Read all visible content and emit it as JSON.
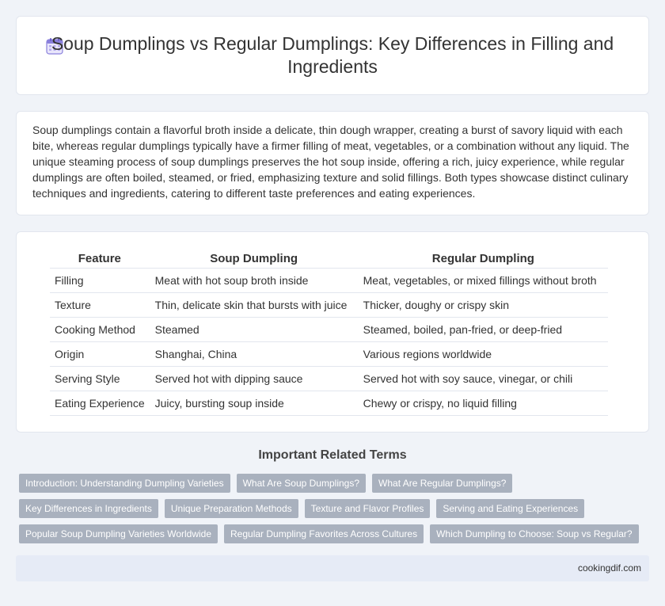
{
  "header": {
    "title": "Soup Dumplings vs Regular Dumplings: Key Differences in Filling and Ingredients",
    "icon": "calendar-icon",
    "icon_color": "#7b6fd6"
  },
  "intro": {
    "text": "Soup dumplings contain a flavorful broth inside a delicate, thin dough wrapper, creating a burst of savory liquid with each bite, whereas regular dumplings typically have a firmer filling of meat, vegetables, or a combination without any liquid. The unique steaming process of soup dumplings preserves the hot soup inside, offering a rich, juicy experience, while regular dumplings are often boiled, steamed, or fried, emphasizing texture and solid fillings. Both types showcase distinct culinary techniques and ingredients, catering to different taste preferences and eating experiences."
  },
  "table": {
    "headers": [
      "Feature",
      "Soup Dumpling",
      "Regular Dumpling"
    ],
    "rows": [
      [
        "Filling",
        "Meat with hot soup broth inside",
        "Meat, vegetables, or mixed fillings without broth"
      ],
      [
        "Texture",
        "Thin, delicate skin that bursts with juice",
        "Thicker, doughy or crispy skin"
      ],
      [
        "Cooking Method",
        "Steamed",
        "Steamed, boiled, pan-fried, or deep-fried"
      ],
      [
        "Origin",
        "Shanghai, China",
        "Various regions worldwide"
      ],
      [
        "Serving Style",
        "Served hot with dipping sauce",
        "Served hot with soy sauce, vinegar, or chili"
      ],
      [
        "Eating Experience",
        "Juicy, bursting soup inside",
        "Chewy or crispy, no liquid filling"
      ]
    ]
  },
  "related": {
    "title": "Important Related Terms",
    "rows": [
      [
        "Introduction: Understanding Dumpling Varieties",
        "What Are Soup Dumplings?",
        "What Are Regular Dumplings?"
      ],
      [
        "Key Differences in Ingredients",
        "Unique Preparation Methods",
        "Texture and Flavor Profiles",
        "Serving and Eating Experiences"
      ],
      [
        "Popular Soup Dumpling Varieties Worldwide",
        "Regular Dumpling Favorites Across Cultures",
        "Which Dumpling to Choose: Soup vs Regular?"
      ]
    ]
  },
  "footer": {
    "text": "cookingdif.com"
  }
}
